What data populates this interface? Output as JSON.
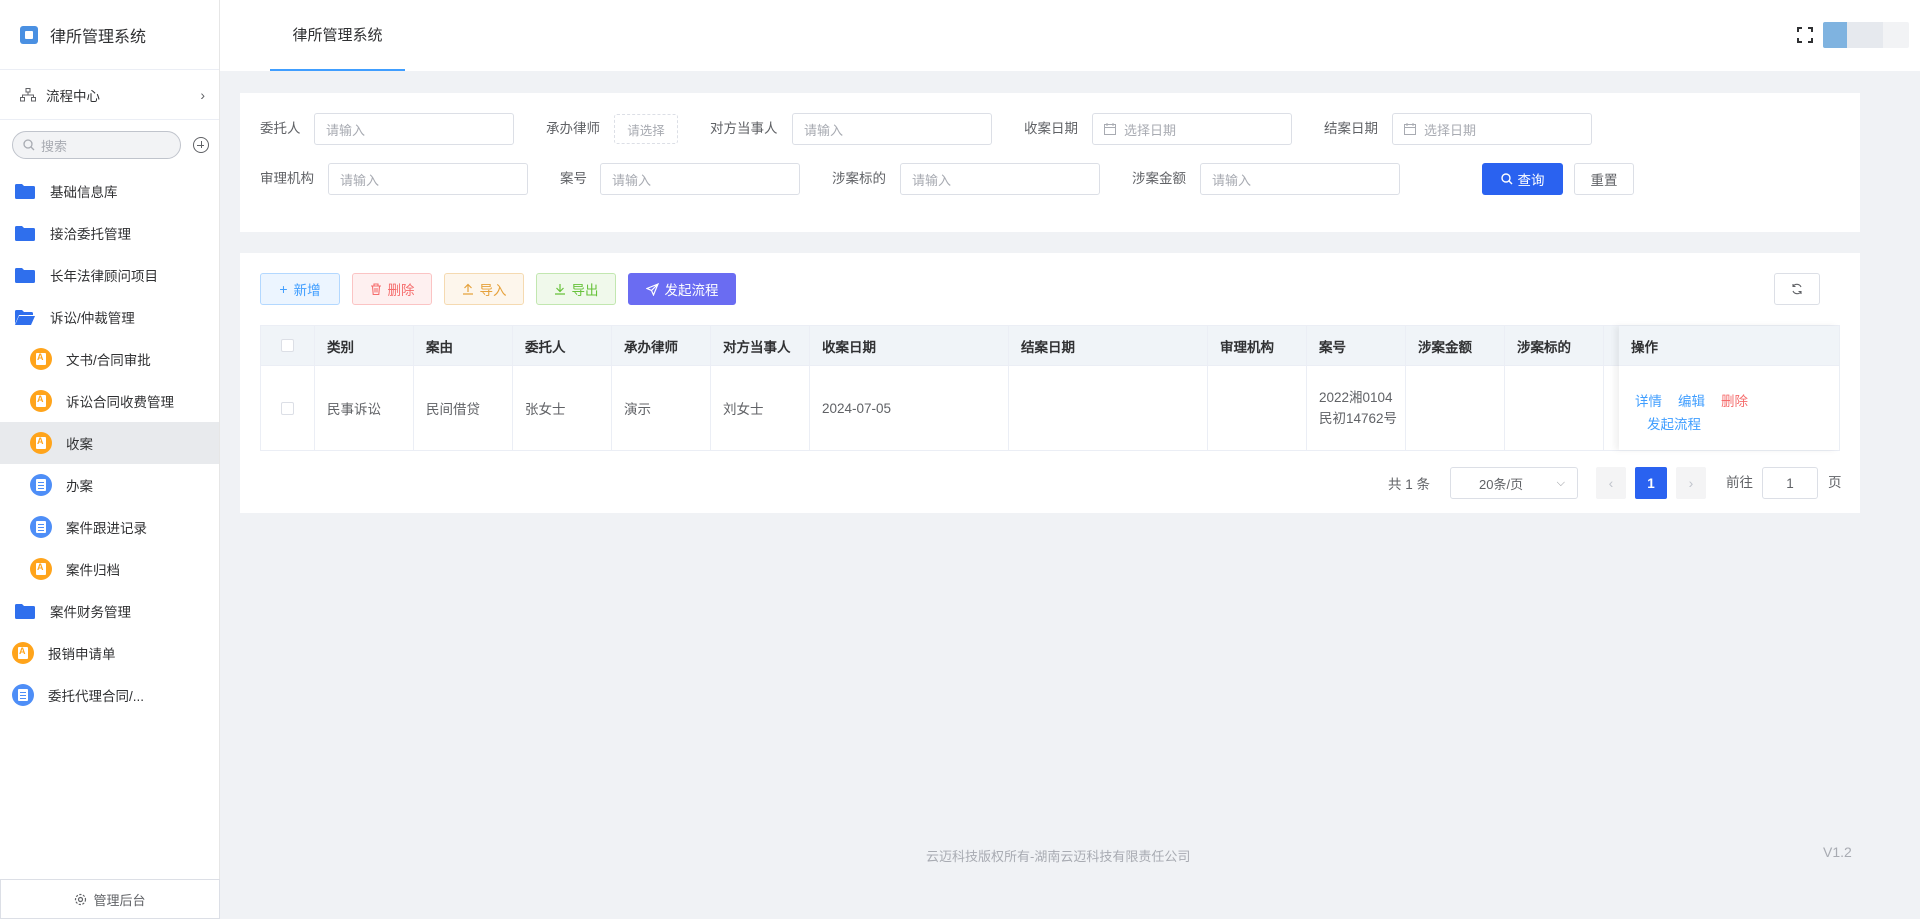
{
  "app": {
    "title": "律所管理系统",
    "flow_center": "流程中心",
    "search_placeholder": "搜索",
    "admin_label": "管理后台"
  },
  "sidebar": {
    "items": [
      {
        "label": "基础信息库",
        "icon": "folder-icon"
      },
      {
        "label": "接洽委托管理",
        "icon": "folder-icon"
      },
      {
        "label": "长年法律顾问项目",
        "icon": "folder-icon"
      },
      {
        "label": "诉讼/仲裁管理",
        "icon": "folder-open-icon"
      },
      {
        "label": "文书/合同审批",
        "icon": "form-icon"
      },
      {
        "label": "诉讼合同收费管理",
        "icon": "form-icon"
      },
      {
        "label": "收案",
        "icon": "form-icon"
      },
      {
        "label": "办案",
        "icon": "list-icon"
      },
      {
        "label": "案件跟进记录",
        "icon": "list-icon"
      },
      {
        "label": "案件归档",
        "icon": "form-icon"
      },
      {
        "label": "案件财务管理",
        "icon": "folder-icon"
      },
      {
        "label": "报销申请单",
        "icon": "form-icon"
      },
      {
        "label": "委托代理合同/...",
        "icon": "list-icon"
      }
    ]
  },
  "header": {
    "tab": "律所管理系统"
  },
  "filter": {
    "client_label": "委托人",
    "client_placeholder": "请输入",
    "lawyer_label": "承办律师",
    "lawyer_placeholder": "请选择",
    "party_label": "对方当事人",
    "party_placeholder": "请输入",
    "accept_date_label": "收案日期",
    "accept_date_placeholder": "选择日期",
    "close_date_label": "结案日期",
    "close_date_placeholder": "选择日期",
    "court_label": "审理机构",
    "court_placeholder": "请输入",
    "case_no_label": "案号",
    "case_no_placeholder": "请输入",
    "subject_label": "涉案标的",
    "subject_placeholder": "请输入",
    "amount_label": "涉案金额",
    "amount_placeholder": "请输入",
    "query_label": "查询",
    "reset_label": "重置"
  },
  "toolbar": {
    "add": "新增",
    "delete": "删除",
    "import": "导入",
    "export": "导出",
    "start_flow": "发起流程"
  },
  "table": {
    "headers": [
      "类别",
      "案由",
      "委托人",
      "承办律师",
      "对方当事人",
      "收案日期",
      "结案日期",
      "审理机构",
      "案号",
      "涉案金额",
      "涉案标的"
    ],
    "ops_header": "操作",
    "rows": [
      {
        "category": "民事诉讼",
        "cause": "民间借贷",
        "client": "张女士",
        "lawyer": "演示",
        "party": "刘女士",
        "accept_date": "2024-07-05",
        "close_date": "",
        "court": "",
        "case_no": "2022湘0104民初14762号",
        "amount": "",
        "subject": ""
      }
    ],
    "ops": {
      "detail": "详情",
      "edit": "编辑",
      "delete": "删除",
      "start_flow": "发起流程"
    }
  },
  "pagination": {
    "total": "共 1 条",
    "page_size": "20条/页",
    "current_page": "1",
    "goto_label": "前往",
    "goto_value": "1",
    "page_unit": "页"
  },
  "footer": {
    "copyright": "云迈科技版权所有-湖南云迈科技有限责任公司",
    "version": "V1.2"
  }
}
